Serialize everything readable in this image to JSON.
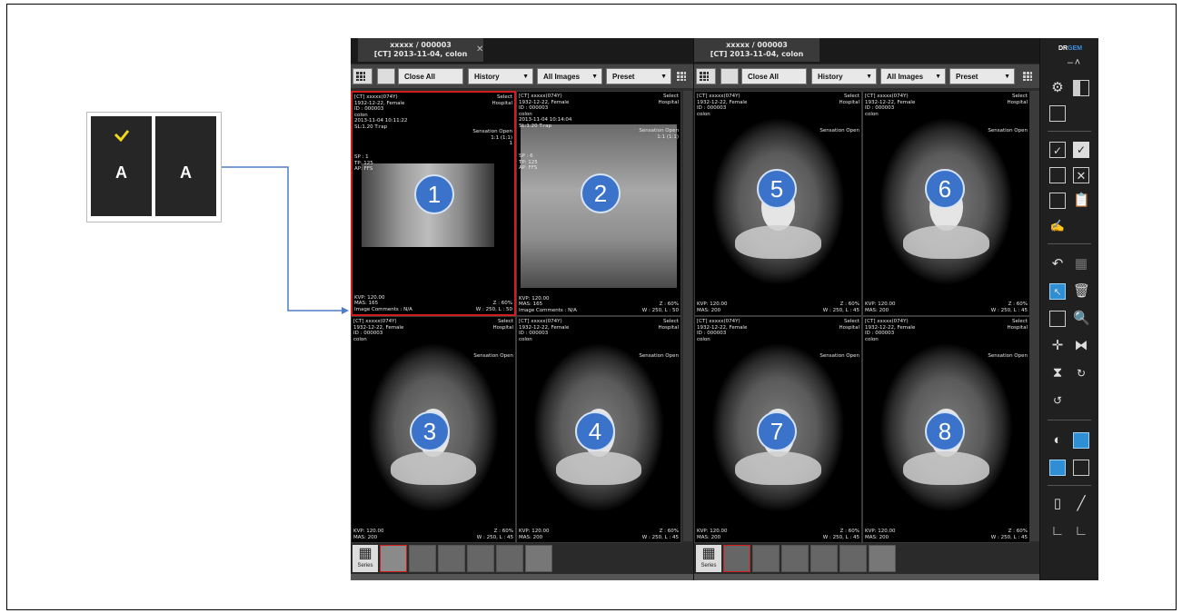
{
  "toggle_callout": {
    "checked_label": "A",
    "unchecked_label": "A",
    "check_color": "#f2d81f"
  },
  "panels": [
    {
      "tab_title_line1": "xxxxx / 000003",
      "tab_title_line2": "[CT] 2013-11-04, colon",
      "close_all": "Close All",
      "history": "History",
      "all_images": "All Images",
      "preset": "Preset",
      "series_label": "Series",
      "viewports": [
        {
          "number": "1",
          "selected": true,
          "top_left": "[CT] xxxxx(074Y)\n1932-12-22, Female\nID : 000003\ncolon\n2013-11-04 10:11:22\nSL:1.20 T:rap",
          "top_right": "Select\nHospital",
          "mid_right": "Sensation Open\n1:1 (1:1)\n1",
          "mid_left": "SP : 1\nTP: 125\nAP: FFS",
          "bottom_left": "KVP: 120.00\nMAS: 165\nImage Comments : N/A",
          "bottom_right": "Z : 60%\nW : 250, L : 50"
        },
        {
          "number": "2",
          "selected": false,
          "top_left": "[CT] xxxxx(074Y)\n1932-12-22, Female\nID : 000003\ncolon\n2013-11-04 10:14:04\nSL:1.20 T:rap",
          "top_right": "Select\nHospital",
          "mid_right": "Sensation Open\n1:1 (1:1)",
          "mid_left": "SP : 6\nTP: 125\nAP: FFS",
          "bottom_left": "KVP: 120.00\nMAS: 165\nImage Comments : N/A",
          "bottom_right": "Z : 60%\nW : 250, L : 50"
        },
        {
          "number": "3",
          "selected": false,
          "top_left": "[CT] xxxxx(074Y)\n1932-12-22, Female\nID : 000003\ncolon",
          "top_right": "Select\nHospital",
          "mid_right": "Sensation Open",
          "mid_left": "",
          "bottom_left": "KVP: 120.00\nMAS: 200",
          "bottom_right": "Z : 60%\nW : 250, L : 45"
        },
        {
          "number": "4",
          "selected": false,
          "top_left": "[CT] xxxxx(074Y)\n1932-12-22, Female\nID : 000003\ncolon",
          "top_right": "Select\nHospital",
          "mid_right": "Sensation Open",
          "mid_left": "",
          "bottom_left": "KVP: 120.00\nMAS: 200",
          "bottom_right": "Z : 60%\nW : 250, L : 45"
        }
      ]
    },
    {
      "tab_title_line1": "xxxxx / 000003",
      "tab_title_line2": "[CT] 2013-11-04, colon",
      "close_all": "Close All",
      "history": "History",
      "all_images": "All Images",
      "preset": "Preset",
      "series_label": "Series",
      "viewports": [
        {
          "number": "5",
          "selected": false,
          "top_left": "[CT] xxxxx(074Y)\n1932-12-22, Female\nID : 000003\ncolon",
          "top_right": "Select\nHospital",
          "mid_right": "Sensation Open",
          "mid_left": "",
          "bottom_left": "KVP: 120.00\nMAS: 200",
          "bottom_right": "Z : 60%\nW : 250, L : 45"
        },
        {
          "number": "6",
          "selected": false,
          "top_left": "[CT] xxxxx(074Y)\n1932-12-22, Female\nID : 000003\ncolon",
          "top_right": "Select\nHospital",
          "mid_right": "Sensation Open",
          "mid_left": "",
          "bottom_left": "KVP: 120.00\nMAS: 200",
          "bottom_right": "Z : 60%\nW : 250, L : 45"
        },
        {
          "number": "7",
          "selected": false,
          "top_left": "[CT] xxxxx(074Y)\n1932-12-22, Female\nID : 000003\ncolon",
          "top_right": "Select\nHospital",
          "mid_right": "Sensation Open",
          "mid_left": "",
          "bottom_left": "KVP: 120.00\nMAS: 200",
          "bottom_right": "Z : 60%\nW : 250, L : 45"
        },
        {
          "number": "8",
          "selected": false,
          "top_left": "[CT] xxxxx(074Y)\n1932-12-22, Female\nID : 000003\ncolon",
          "top_right": "Select\nHospital",
          "mid_right": "Sensation Open",
          "mid_left": "",
          "bottom_left": "KVP: 120.00\nMAS: 200",
          "bottom_right": "Z : 60%\nW : 250, L : 45"
        }
      ]
    }
  ],
  "right_toolbar": {
    "brand_dr": "DR",
    "brand_gem": "GEM",
    "brand_dr_color": "#ffffff",
    "brand_gem_color": "#3b8fe0",
    "icons": [
      "minimize-icon",
      "close-icon",
      "settings-icon",
      "layout-icon",
      "split-layout-icon",
      "check-icon",
      "check-all-icon",
      "export-icon",
      "close-box-icon",
      "save-icon",
      "clipboard-icon",
      "signature-icon",
      "undo-icon",
      "grid-icon",
      "select-cursor-icon",
      "delete-icon",
      "zoom-box-icon",
      "magnifier-icon",
      "pan-icon",
      "flip-icon",
      "rotate-icon",
      "rotate-90-icon",
      "rotate-back-icon",
      "invert-icon",
      "window-level-icon",
      "fit-icon",
      "annotation-icon",
      "ruler-icon",
      "line-icon",
      "angle-icon",
      "cobb-angle-icon"
    ]
  },
  "number_badge_color": "#3a73c9",
  "selected_border_color": "#d01e1e",
  "connector_color": "#4f7ec6"
}
